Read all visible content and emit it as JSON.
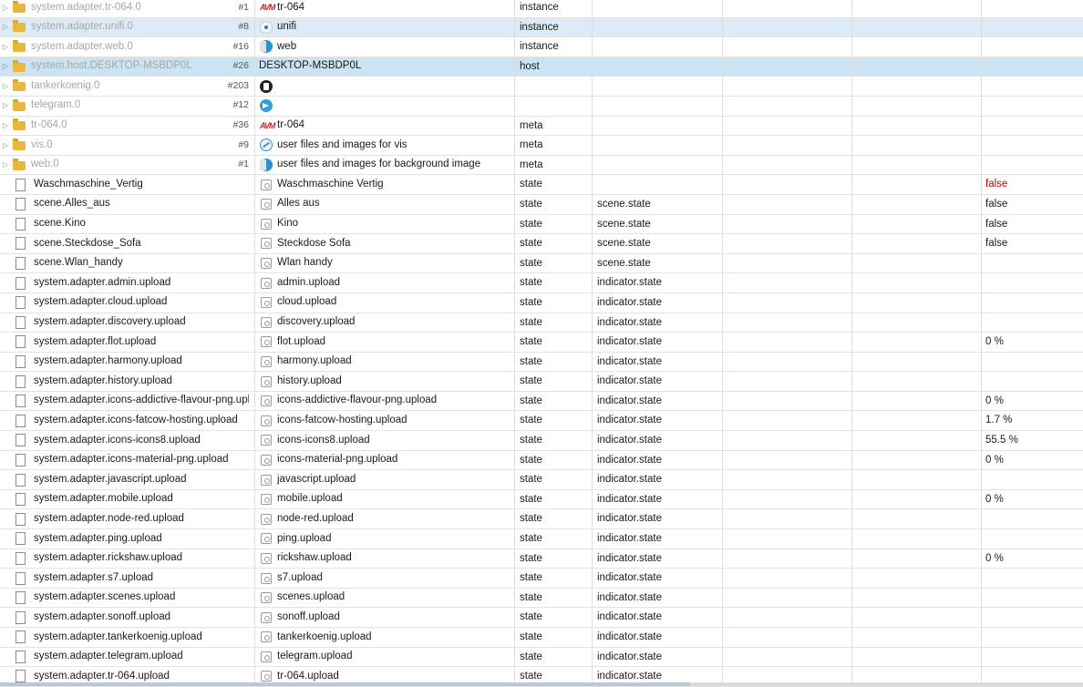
{
  "rows": [
    {
      "id": "system.adapter.tr-064.0",
      "count": "#1",
      "icon": "fritz",
      "name": "tr-064",
      "type": "instance",
      "role": "",
      "value": "",
      "kind": "folder",
      "state": ""
    },
    {
      "id": "system.adapter.unifi.0",
      "count": "#8",
      "icon": "unifi",
      "name": "unifi",
      "type": "instance",
      "role": "",
      "value": "",
      "kind": "folder",
      "state": "sel"
    },
    {
      "id": "system.adapter.web.0",
      "count": "#16",
      "icon": "web",
      "name": "web",
      "type": "instance",
      "role": "",
      "value": "",
      "kind": "folder",
      "state": ""
    },
    {
      "id": "system.host.DESKTOP-MSBDP0L",
      "count": "#26",
      "icon": "",
      "name": "DESKTOP-MSBDP0L",
      "type": "host",
      "role": "",
      "value": "",
      "kind": "folder",
      "state": "sel2"
    },
    {
      "id": "tankerkoenig.0",
      "count": "#203",
      "icon": "tank",
      "name": "",
      "type": "",
      "role": "",
      "value": "",
      "kind": "folder",
      "state": ""
    },
    {
      "id": "telegram.0",
      "count": "#12",
      "icon": "telegram",
      "name": "",
      "type": "",
      "role": "",
      "value": "",
      "kind": "folder",
      "state": ""
    },
    {
      "id": "tr-064.0",
      "count": "#36",
      "icon": "fritz",
      "name": "tr-064",
      "type": "meta",
      "role": "",
      "value": "",
      "kind": "folder",
      "state": ""
    },
    {
      "id": "vis.0",
      "count": "#9",
      "icon": "vis",
      "name": "user files and images for vis",
      "type": "meta",
      "role": "",
      "value": "",
      "kind": "folder",
      "state": ""
    },
    {
      "id": "web.0",
      "count": "#1",
      "icon": "web",
      "name": "user files and images for background image",
      "type": "meta",
      "role": "",
      "value": "",
      "kind": "folder",
      "state": ""
    },
    {
      "id": "Waschmaschine_Vertig",
      "count": "",
      "icon": "state",
      "name": "Waschmaschine Vertig",
      "type": "state",
      "role": "",
      "value": "false",
      "valueColor": "red",
      "kind": "file",
      "state": ""
    },
    {
      "id": "scene.Alles_aus",
      "count": "",
      "icon": "state",
      "name": "Alles aus",
      "type": "state",
      "role": "scene.state",
      "value": "false",
      "kind": "file",
      "state": ""
    },
    {
      "id": "scene.Kino",
      "count": "",
      "icon": "state",
      "name": "Kino",
      "type": "state",
      "role": "scene.state",
      "value": "false",
      "kind": "file",
      "state": ""
    },
    {
      "id": "scene.Steckdose_Sofa",
      "count": "",
      "icon": "state",
      "name": "Steckdose Sofa",
      "type": "state",
      "role": "scene.state",
      "value": "false",
      "kind": "file",
      "state": ""
    },
    {
      "id": "scene.Wlan_handy",
      "count": "",
      "icon": "state",
      "name": "Wlan handy",
      "type": "state",
      "role": "scene.state",
      "value": "",
      "kind": "file",
      "state": ""
    },
    {
      "id": "system.adapter.admin.upload",
      "count": "",
      "icon": "state",
      "name": "admin.upload",
      "type": "state",
      "role": "indicator.state",
      "value": "",
      "kind": "file",
      "state": ""
    },
    {
      "id": "system.adapter.cloud.upload",
      "count": "",
      "icon": "state",
      "name": "cloud.upload",
      "type": "state",
      "role": "indicator.state",
      "value": "",
      "kind": "file",
      "state": ""
    },
    {
      "id": "system.adapter.discovery.upload",
      "count": "",
      "icon": "state",
      "name": "discovery.upload",
      "type": "state",
      "role": "indicator.state",
      "value": "",
      "kind": "file",
      "state": ""
    },
    {
      "id": "system.adapter.flot.upload",
      "count": "",
      "icon": "state",
      "name": "flot.upload",
      "type": "state",
      "role": "indicator.state",
      "value": "0 %",
      "kind": "file",
      "state": ""
    },
    {
      "id": "system.adapter.harmony.upload",
      "count": "",
      "icon": "state",
      "name": "harmony.upload",
      "type": "state",
      "role": "indicator.state",
      "value": "",
      "kind": "file",
      "state": ""
    },
    {
      "id": "system.adapter.history.upload",
      "count": "",
      "icon": "state",
      "name": "history.upload",
      "type": "state",
      "role": "indicator.state",
      "value": "",
      "kind": "file",
      "state": ""
    },
    {
      "id": "system.adapter.icons-addictive-flavour-png.uploa",
      "count": "",
      "icon": "state",
      "name": "icons-addictive-flavour-png.upload",
      "type": "state",
      "role": "indicator.state",
      "value": "0 %",
      "kind": "file",
      "state": ""
    },
    {
      "id": "system.adapter.icons-fatcow-hosting.upload",
      "count": "",
      "icon": "state",
      "name": "icons-fatcow-hosting.upload",
      "type": "state",
      "role": "indicator.state",
      "value": "1.7 %",
      "kind": "file",
      "state": ""
    },
    {
      "id": "system.adapter.icons-icons8.upload",
      "count": "",
      "icon": "state",
      "name": "icons-icons8.upload",
      "type": "state",
      "role": "indicator.state",
      "value": "55.5 %",
      "kind": "file",
      "state": ""
    },
    {
      "id": "system.adapter.icons-material-png.upload",
      "count": "",
      "icon": "state",
      "name": "icons-material-png.upload",
      "type": "state",
      "role": "indicator.state",
      "value": "0 %",
      "kind": "file",
      "state": ""
    },
    {
      "id": "system.adapter.javascript.upload",
      "count": "",
      "icon": "state",
      "name": "javascript.upload",
      "type": "state",
      "role": "indicator.state",
      "value": "",
      "kind": "file",
      "state": ""
    },
    {
      "id": "system.adapter.mobile.upload",
      "count": "",
      "icon": "state",
      "name": "mobile.upload",
      "type": "state",
      "role": "indicator.state",
      "value": "0 %",
      "kind": "file",
      "state": ""
    },
    {
      "id": "system.adapter.node-red.upload",
      "count": "",
      "icon": "state",
      "name": "node-red.upload",
      "type": "state",
      "role": "indicator.state",
      "value": "",
      "kind": "file",
      "state": ""
    },
    {
      "id": "system.adapter.ping.upload",
      "count": "",
      "icon": "state",
      "name": "ping.upload",
      "type": "state",
      "role": "indicator.state",
      "value": "",
      "kind": "file",
      "state": ""
    },
    {
      "id": "system.adapter.rickshaw.upload",
      "count": "",
      "icon": "state",
      "name": "rickshaw.upload",
      "type": "state",
      "role": "indicator.state",
      "value": "0 %",
      "kind": "file",
      "state": ""
    },
    {
      "id": "system.adapter.s7.upload",
      "count": "",
      "icon": "state",
      "name": "s7.upload",
      "type": "state",
      "role": "indicator.state",
      "value": "",
      "kind": "file",
      "state": ""
    },
    {
      "id": "system.adapter.scenes.upload",
      "count": "",
      "icon": "state",
      "name": "scenes.upload",
      "type": "state",
      "role": "indicator.state",
      "value": "",
      "kind": "file",
      "state": ""
    },
    {
      "id": "system.adapter.sonoff.upload",
      "count": "",
      "icon": "state",
      "name": "sonoff.upload",
      "type": "state",
      "role": "indicator.state",
      "value": "",
      "kind": "file",
      "state": ""
    },
    {
      "id": "system.adapter.tankerkoenig.upload",
      "count": "",
      "icon": "state",
      "name": "tankerkoenig.upload",
      "type": "state",
      "role": "indicator.state",
      "value": "",
      "kind": "file",
      "state": ""
    },
    {
      "id": "system.adapter.telegram.upload",
      "count": "",
      "icon": "state",
      "name": "telegram.upload",
      "type": "state",
      "role": "indicator.state",
      "value": "",
      "kind": "file",
      "state": ""
    },
    {
      "id": "system.adapter.tr-064.upload",
      "count": "",
      "icon": "state",
      "name": "tr-064.upload",
      "type": "state",
      "role": "indicator.state",
      "value": "",
      "kind": "file",
      "state": ""
    }
  ]
}
